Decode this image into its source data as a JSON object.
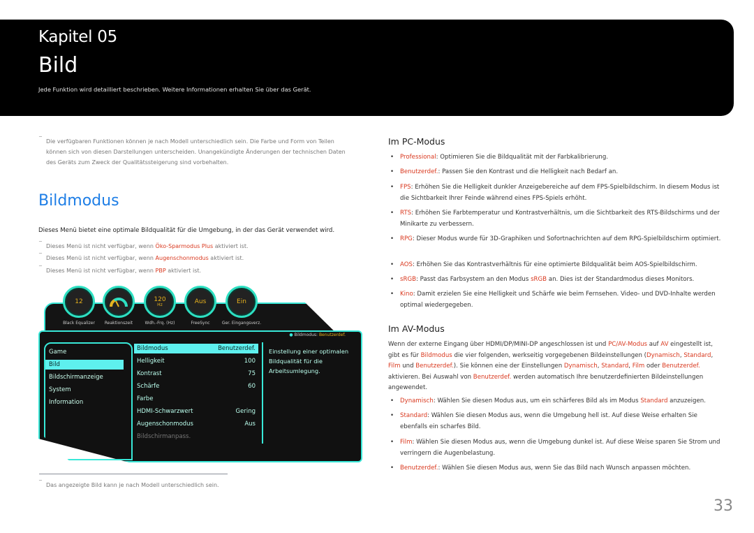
{
  "header": {
    "chapter": "Kapitel 05",
    "title": "Bild",
    "subtitle": "Jede Funktion wird detailliert beschrieben. Weitere Informationen erhalten Sie über das Gerät."
  },
  "notes_top": {
    "line1": "Die verfügbaren Funktionen können je nach Modell unterschiedlich sein. Die Farbe und Form von Teilen",
    "line2": "können sich von diesen Darstellungen unterscheiden. Unangekündigte Änderungen der technischen Daten",
    "line3": "des Geräts zum Zweck der Qualitätssteigerung sind vorbehalten."
  },
  "section": {
    "heading": "Bildmodus",
    "intro": "Dieses Menü bietet eine optimale Bildqualität für die Umgebung, in der das Gerät verwendet wird.",
    "notes": [
      {
        "pre": "Dieses Menü ist nicht verfügbar, wenn ",
        "hl": "Öko-Sparmodus Plus",
        "post": " aktiviert ist."
      },
      {
        "pre": "Dieses Menü ist nicht verfügbar, wenn ",
        "hl": "Augenschonmodus",
        "post": " aktiviert ist."
      },
      {
        "pre": "Dieses Menü ist nicht verfügbar, wenn ",
        "hl": "PBP",
        "post": " aktiviert ist."
      }
    ]
  },
  "osd": {
    "knobs": [
      {
        "value": "12",
        "unit": "",
        "label": "Black Equalizer"
      },
      {
        "value": "",
        "unit": "",
        "label": "Reaktionszeit"
      },
      {
        "value": "120",
        "unit": "Hz",
        "label": "Wdh.-Frq. (Hz)"
      },
      {
        "value": "Aus",
        "unit": "",
        "label": "FreeSync"
      },
      {
        "value": "Ein",
        "unit": "",
        "label": "Ger. Eingangsverz."
      }
    ],
    "mode_label": "Bildmodus: ",
    "mode_value": "Benutzerdef.",
    "menu": [
      "Game",
      "Bild",
      "Bildschirmanzeige",
      "System",
      "Information"
    ],
    "menu_selected": 1,
    "settings": [
      {
        "label": "Bildmodus",
        "value": "Benutzerdef."
      },
      {
        "label": "Helligkeit",
        "value": "100"
      },
      {
        "label": "Kontrast",
        "value": "75"
      },
      {
        "label": "Schärfe",
        "value": "60"
      },
      {
        "label": "Farbe",
        "value": ""
      },
      {
        "label": "HDMI-Schwarzwert",
        "value": "Gering"
      },
      {
        "label": "Augenschonmodus",
        "value": "Aus"
      },
      {
        "label": "Bildschirmanpass.",
        "value": ""
      }
    ],
    "description": "Einstellung einer optimalen Bildqualität für die Arbeitsumlegung."
  },
  "footnote": "Das angezeigte Bild kann je nach Modell unterschiedlich sein.",
  "pc_mode": {
    "heading": "Im PC-Modus",
    "items": [
      {
        "term": "Professional",
        "text": ": Optimieren Sie die Bildqualität mit der Farbkalibrierung."
      },
      {
        "term": "Benutzerdef.",
        "text": ": Passen Sie den Kontrast und die Helligkeit nach Bedarf an."
      },
      {
        "term": "FPS",
        "text": ": Erhöhen Sie die Helligkeit dunkler Anzeigebereiche auf dem FPS-Spielbildschirm. In diesem Modus ist die Sichtbarkeit Ihrer Feinde während eines FPS-Spiels erhöht."
      },
      {
        "term": "RTS",
        "text": ": Erhöhen Sie Farbtemperatur und Kontrastverhältnis, um die Sichtbarkeit des RTS-Bildschirms und der Minikarte zu verbessern."
      },
      {
        "term": "RPG",
        "text": ": Dieser Modus wurde für 3D-Graphiken und Sofortnachrichten auf dem RPG-Spielbildschirm optimiert."
      },
      {
        "term": "AOS",
        "text": ": Erhöhen Sie das Kontrastverhältnis für eine optimierte Bildqualität beim AOS-Spielbildschirm."
      },
      {
        "term": "sRGB",
        "text": ": Passt das Farbsystem an den Modus ",
        "term2": "sRGB",
        "text2": " an. Dies ist der Standardmodus dieses Monitors."
      },
      {
        "term": "Kino",
        "text": ": Damit erzielen Sie eine Helligkeit und Schärfe wie beim Fernsehen. Video- und DVD-Inhalte werden optimal wiedergegeben."
      }
    ]
  },
  "av_mode": {
    "heading": "Im AV-Modus",
    "para": [
      {
        "t": "Wenn der externe Eingang über HDMI/DP/MINI-DP angeschlossen ist und "
      },
      {
        "h": "PC/AV-Modus"
      },
      {
        "t": " auf "
      },
      {
        "h": "AV"
      },
      {
        "t": " eingestellt ist, gibt es für "
      },
      {
        "h": "Bildmodus"
      },
      {
        "t": " die vier folgenden, werkseitig vorgegebenen Bildeinstellungen ("
      },
      {
        "h": "Dynamisch"
      },
      {
        "t": ", "
      },
      {
        "h": "Standard"
      },
      {
        "t": ", "
      },
      {
        "h": "Film"
      },
      {
        "t": " und "
      },
      {
        "h": "Benutzerdef."
      },
      {
        "t": "). Sie können eine der Einstellungen "
      },
      {
        "h": "Dynamisch"
      },
      {
        "t": ", "
      },
      {
        "h": "Standard"
      },
      {
        "t": ", "
      },
      {
        "h": "Film"
      },
      {
        "t": " oder "
      },
      {
        "h": "Benutzerdef."
      },
      {
        "t": " aktivieren. Bei Auswahl von "
      },
      {
        "h": "Benutzerdef."
      },
      {
        "t": " werden automatisch Ihre benutzerdefinierten Bildeinstellungen angewendet."
      }
    ],
    "items": [
      {
        "term": "Dynamisch",
        "text": ": Wählen Sie diesen Modus aus, um ein schärferes Bild als im Modus ",
        "term2": "Standard",
        "text2": " anzuzeigen."
      },
      {
        "term": "Standard",
        "text": ": Wählen Sie diesen Modus aus, wenn die Umgebung hell ist. Auf diese Weise erhalten Sie ebenfalls ein scharfes Bild."
      },
      {
        "term": "Film",
        "text": ": Wählen Sie diesen Modus aus, wenn die Umgebung dunkel ist. Auf diese Weise sparen Sie Strom und verringern die Augenbelastung."
      },
      {
        "term": "Benutzerdef.",
        "text": ": Wählen Sie diesen Modus aus, wenn Sie das Bild nach Wunsch anpassen möchten."
      }
    ]
  },
  "page_number": "33",
  "colors": {
    "accent_red": "#d9381e",
    "heading_blue": "#1e7ee6",
    "osd_cyan": "#38e8d8",
    "osd_value": "#e8b21d"
  }
}
